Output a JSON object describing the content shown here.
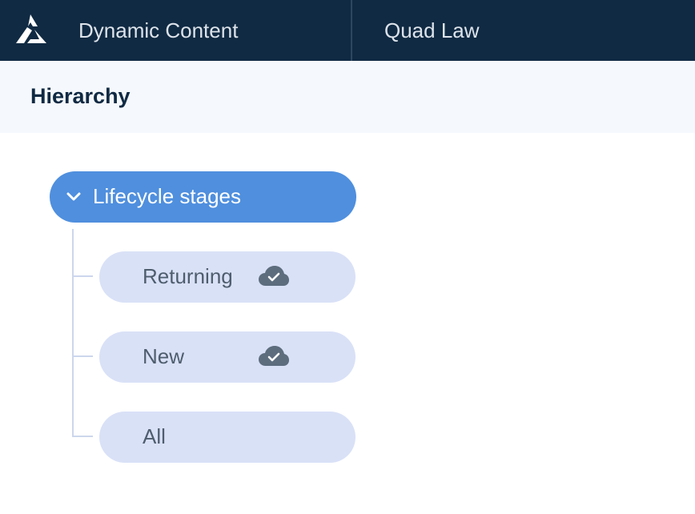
{
  "topbar": {
    "logo_icon": "brand-triangle-logo-icon",
    "app_title": "Dynamic Content",
    "account_name": "Quad Law",
    "background": "#102a43"
  },
  "subheader": {
    "title": "Hierarchy"
  },
  "hierarchy": {
    "root": {
      "label": "Lifecycle stages",
      "expanded": true,
      "icon": "chevron-down-icon",
      "color": "#4f8fde"
    },
    "children": [
      {
        "label": "Returning",
        "status_icon": "cloud-check-icon"
      },
      {
        "label": "New",
        "status_icon": "cloud-check-icon"
      },
      {
        "label": "All",
        "status_icon": ""
      }
    ],
    "child_color": "#d9e1f7"
  }
}
